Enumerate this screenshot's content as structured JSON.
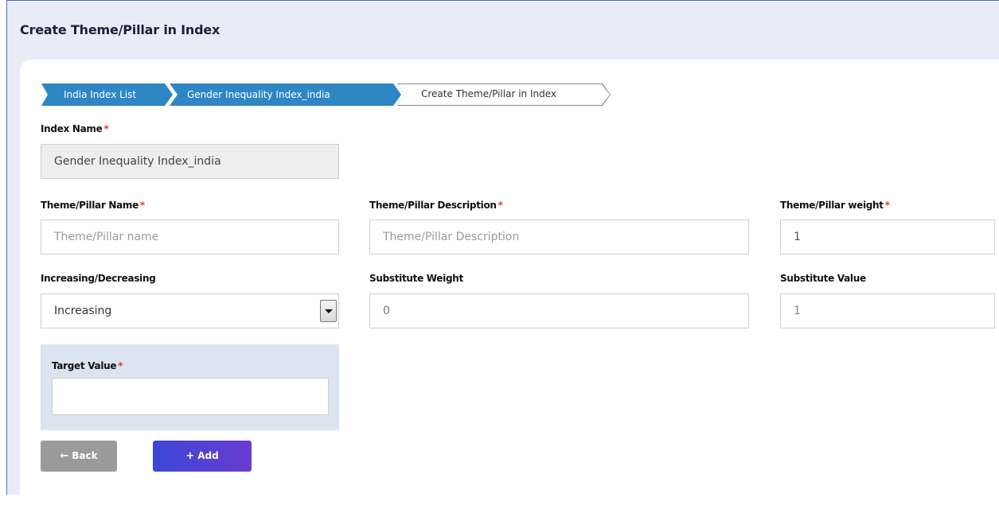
{
  "page": {
    "title": "Create Theme/Pillar in Index"
  },
  "breadcrumb": [
    {
      "label": "India Index List"
    },
    {
      "label": "Gender Inequality Index_india"
    },
    {
      "label": "Create Theme/Pillar in Index"
    }
  ],
  "form": {
    "index_name": {
      "label": "Index Name",
      "value": "Gender Inequality Index_india"
    },
    "theme_name": {
      "label": "Theme/Pillar Name",
      "placeholder": "Theme/Pillar name"
    },
    "theme_description": {
      "label": "Theme/Pillar Description",
      "placeholder": "Theme/Pillar Description"
    },
    "theme_weight": {
      "label": "Theme/Pillar weight",
      "value": "1"
    },
    "direction": {
      "label": "Increasing/Decreasing",
      "selected": "Increasing"
    },
    "substitute_weight": {
      "label": "Substitute Weight",
      "value": "0"
    },
    "substitute_value": {
      "label": "Substitute Value",
      "value": "1"
    },
    "target_value": {
      "label": "Target Value",
      "value": ""
    },
    "required_mark": "*"
  },
  "buttons": {
    "back": {
      "label": "Back",
      "icon": "arrow-left-icon"
    },
    "add": {
      "label": "Add",
      "icon": "plus-icon"
    }
  },
  "colors": {
    "breadcrumb_active": "#2e86c5",
    "required": "#e53935",
    "add_button": "#3b47d6",
    "back_button": "#9a9a9a",
    "target_panel": "#dce4f2"
  }
}
